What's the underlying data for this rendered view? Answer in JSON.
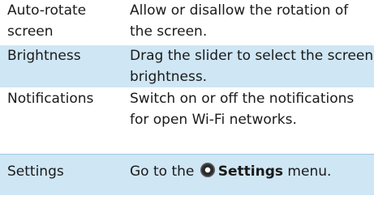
{
  "rows": [
    {
      "term": "Auto-rotate screen",
      "description": "Allow or disallow the rotation of the screen."
    },
    {
      "term": "Brightness",
      "description": "Drag the slider to select the screen brightness."
    },
    {
      "term": "Notifications",
      "description": "Switch on or off the notifications for open Wi-Fi networks."
    },
    {
      "term": "Settings",
      "description_prefix": "Go to the",
      "description_icon": "settings-gear-icon",
      "description_bold": "Settings",
      "description_suffix": "menu."
    }
  ],
  "colors": {
    "highlight_row": "#cfe6f4",
    "divider": "#9fc9e4"
  }
}
